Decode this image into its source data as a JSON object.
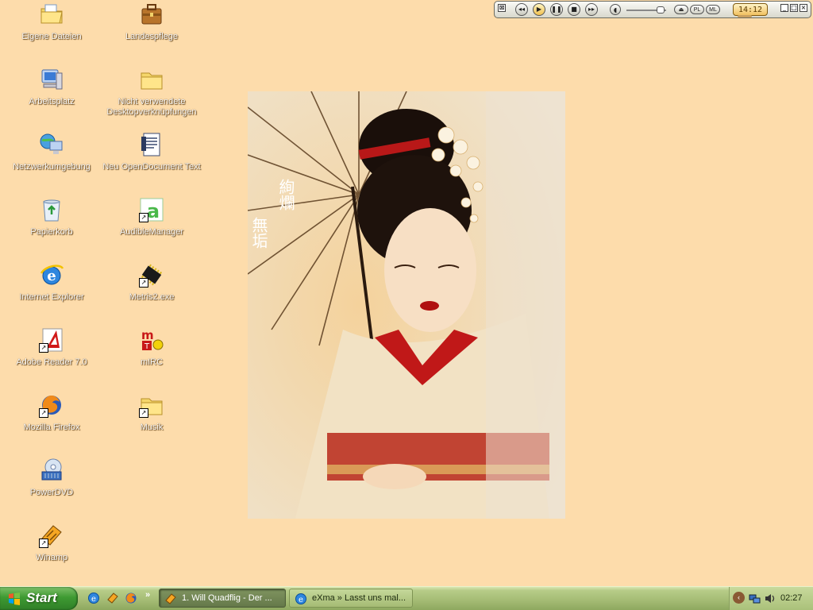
{
  "desktop": {
    "icons": [
      {
        "label": "Eigene Dateien",
        "icon": "my-documents-folder-icon"
      },
      {
        "label": "Landespflege",
        "icon": "briefcase-icon"
      },
      {
        "label": "Arbeitsplatz",
        "icon": "my-computer-icon"
      },
      {
        "label": "Nicht verwendete Desktopverknüpfungen",
        "icon": "folder-icon"
      },
      {
        "label": "Netzwerkumgebung",
        "icon": "network-places-icon"
      },
      {
        "label": "Neu OpenDocument Text",
        "icon": "document-icon"
      },
      {
        "label": "Papierkorb",
        "icon": "recycle-bin-icon"
      },
      {
        "label": "AudibleManager",
        "icon": "audible-icon"
      },
      {
        "label": "Internet Explorer",
        "icon": "internet-explorer-icon"
      },
      {
        "label": "Metris2.exe",
        "icon": "chip-icon"
      },
      {
        "label": "Adobe Reader 7.0",
        "icon": "adobe-reader-icon"
      },
      {
        "label": "mIRC",
        "icon": "mirc-icon"
      },
      {
        "label": "Mozilla Firefox",
        "icon": "firefox-icon"
      },
      {
        "label": "Musik",
        "icon": "folder-icon"
      },
      {
        "label": "PowerDVD",
        "icon": "powerdvd-icon"
      },
      {
        "label": "Winamp",
        "icon": "winamp-icon"
      }
    ]
  },
  "wallpaper": {
    "calligraphy_1": "絢爛",
    "calligraphy_2": "無垢"
  },
  "winamp": {
    "time": "14:12",
    "buttons": {
      "prev": "◂◂",
      "play": "▶",
      "pause": "❚❚",
      "stop": "■",
      "next": "▸▸",
      "eject": "⏏",
      "pl": "PL",
      "ml": "ML"
    }
  },
  "taskbar": {
    "start_label": "Start",
    "quicklaunch_more": "»",
    "tasks": [
      {
        "label": "1. Will Quadflig - Der ...",
        "icon": "winamp-icon",
        "active": true
      },
      {
        "label": "eXma » Lasst uns mal...",
        "icon": "internet-explorer-icon",
        "active": false
      }
    ],
    "tray": {
      "chevron": "‹",
      "clock": "02:27"
    }
  },
  "colors": {
    "desktop_bg": "#fddcab",
    "taskbar": "#a6bd76",
    "start_button": "#3e9a32"
  }
}
